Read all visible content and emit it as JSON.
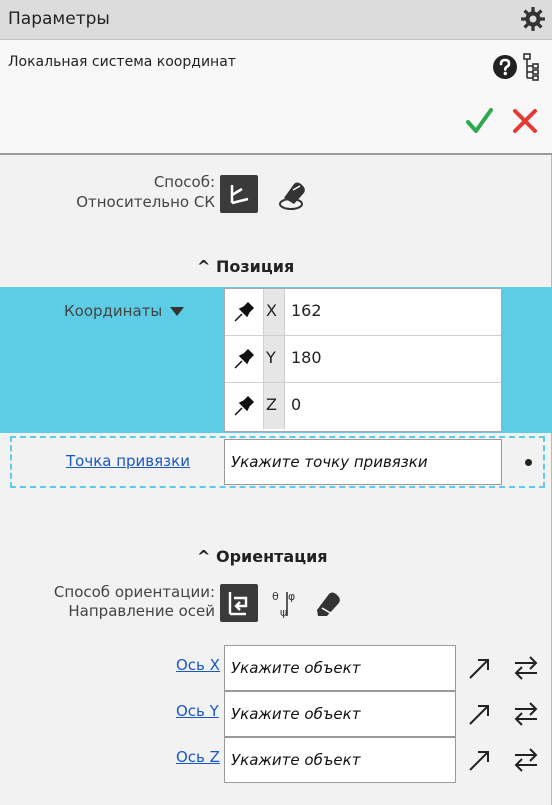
{
  "window": {
    "title": "Параметры"
  },
  "command": {
    "name": "Локальная система координат"
  },
  "method": {
    "label": "Способ:",
    "value": "Относительно СК"
  },
  "position": {
    "section_title": "Позиция",
    "coords_label": "Координаты",
    "rows": [
      {
        "axis": "X",
        "value": "162"
      },
      {
        "axis": "Y",
        "value": "180"
      },
      {
        "axis": "Z",
        "value": "0"
      }
    ],
    "anchor_link": "Точка привязки",
    "anchor_placeholder": "Укажите точку привязки"
  },
  "orientation": {
    "section_title": "Ориентация",
    "method_label": "Способ ориентации:",
    "method_value": "Направление осей",
    "axes": [
      {
        "link": "Ось X",
        "placeholder": "Укажите объект"
      },
      {
        "link": "Ось Y",
        "placeholder": "Укажите объект"
      },
      {
        "link": "Ось Z",
        "placeholder": "Укажите объект"
      }
    ]
  },
  "colors": {
    "accent": "#5ccde4",
    "ok": "#2fa84f",
    "cancel": "#e53935",
    "link": "#1a57c4"
  }
}
